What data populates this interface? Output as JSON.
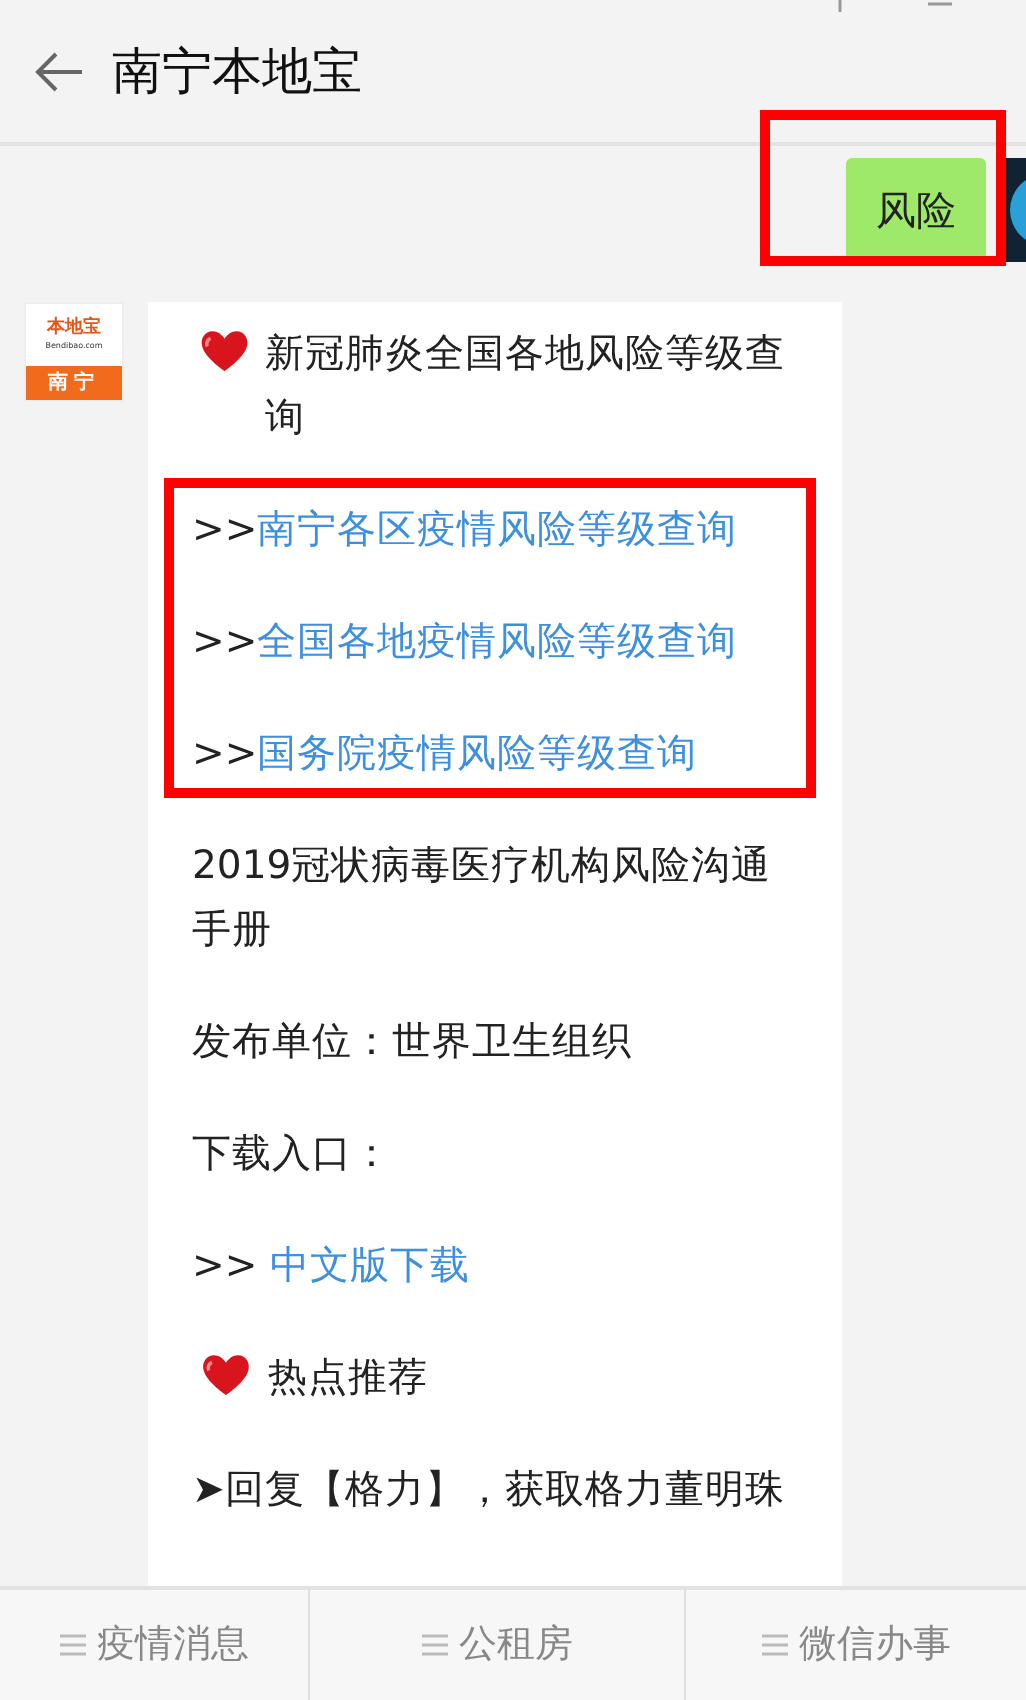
{
  "header": {
    "title": "南宁本地宝"
  },
  "outgoing": {
    "text": "风险",
    "highlighted": true
  },
  "incoming": {
    "avatar": {
      "brand": "本地宝",
      "site": "Bendibao.com",
      "city": "南宁"
    },
    "blocks": [
      {
        "kind": "heart",
        "text": "新冠肺炎全国各地风险等级查询"
      },
      {
        "kind": "links",
        "highlighted": true,
        "items": [
          {
            "prefix": ">>",
            "text": "南宁各区疫情风险等级查询"
          },
          {
            "prefix": ">>",
            "text": "全国各地疫情风险等级查询"
          },
          {
            "prefix": ">>",
            "text": "国务院疫情风险等级查询"
          }
        ]
      },
      {
        "kind": "text",
        "text": "2019冠状病毒医疗机构风险沟通手册"
      },
      {
        "kind": "text",
        "text": "发布单位：世界卫生组织"
      },
      {
        "kind": "text",
        "text": "下载入口："
      },
      {
        "kind": "link",
        "prefix": ">>",
        "text": "中文版下载"
      },
      {
        "kind": "heart",
        "text": "热点推荐"
      },
      {
        "kind": "text",
        "text": "➤回复【格力】，获取格力董明珠"
      }
    ]
  },
  "menu": [
    {
      "label": "疫情消息"
    },
    {
      "label": "公租房"
    },
    {
      "label": "微信办事"
    }
  ]
}
